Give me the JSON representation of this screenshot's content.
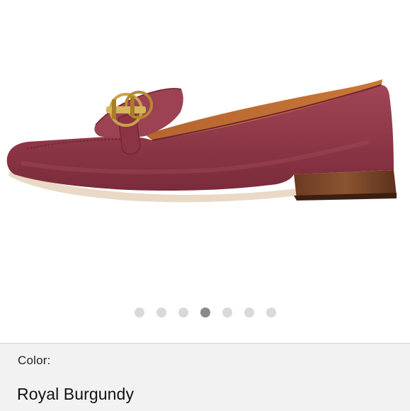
{
  "product": {
    "image_alt": "Burgundy suede loafer with gold logo hardware",
    "carousel": {
      "total": 7,
      "active_index": 3
    }
  },
  "details": {
    "color_label": "Color:",
    "color_value": "Royal Burgundy"
  },
  "colors": {
    "suede": "#923a4a",
    "dot_inactive": "#d9d9d9",
    "dot_active": "#8a8a8a",
    "panel_bg": "#f2f2f2"
  }
}
